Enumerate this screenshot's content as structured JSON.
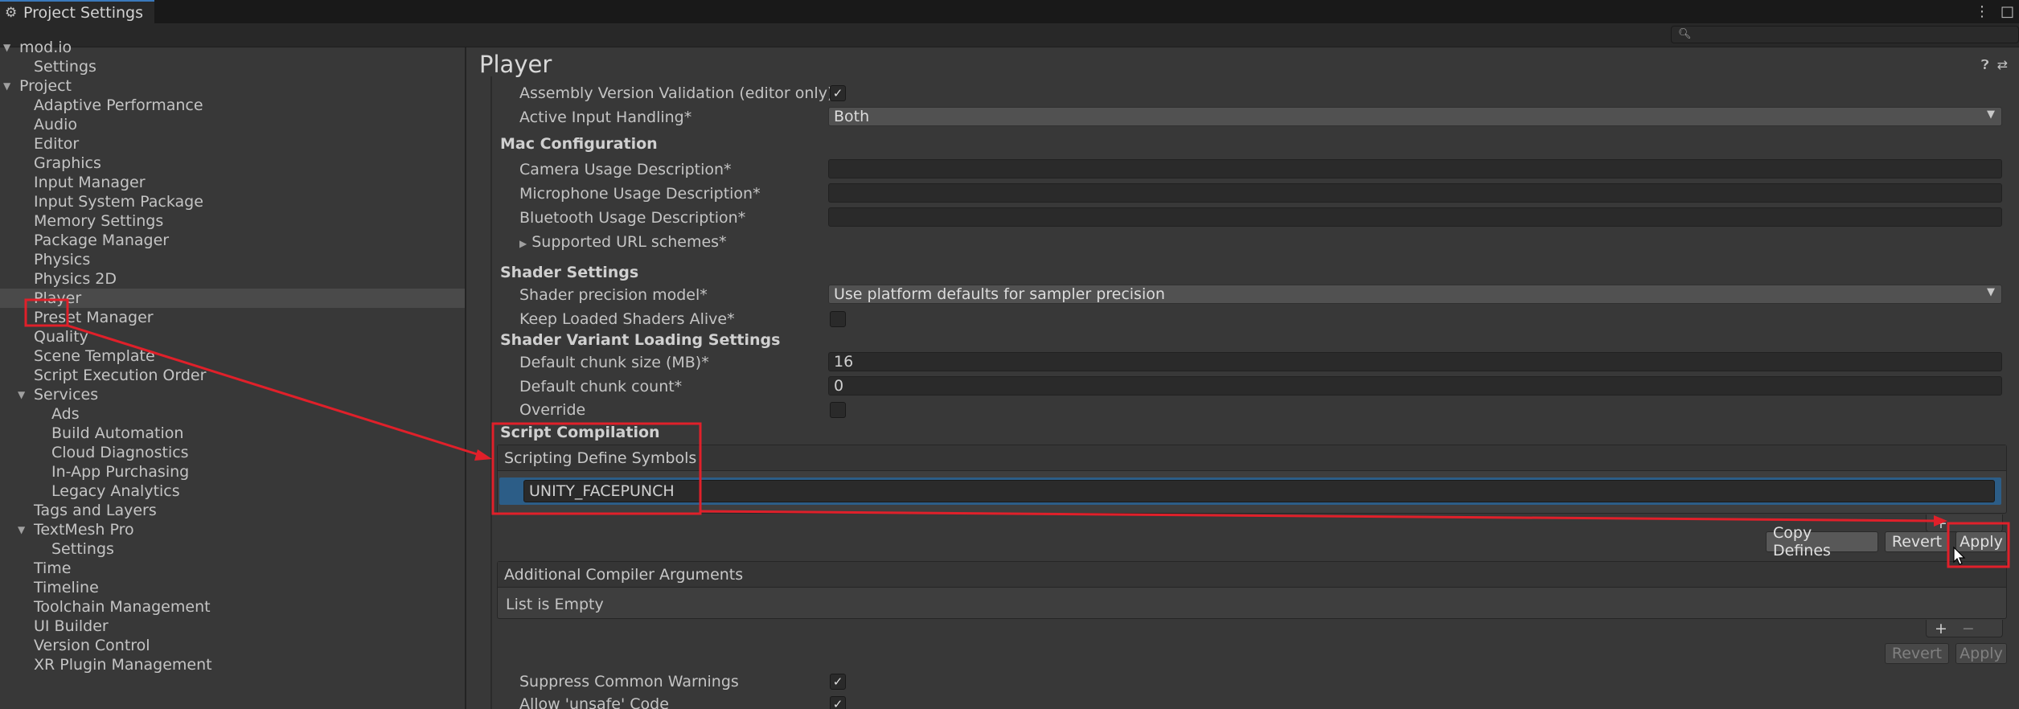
{
  "window": {
    "title": "Project Settings"
  },
  "search": {
    "placeholder": ""
  },
  "sidebar": {
    "items": [
      {
        "label": "mod.io",
        "level": 0,
        "expanded": true
      },
      {
        "label": "Settings",
        "level": 1
      },
      {
        "label": "Project",
        "level": 0,
        "expanded": true
      },
      {
        "label": "Adaptive Performance",
        "level": 1
      },
      {
        "label": "Audio",
        "level": 1
      },
      {
        "label": "Editor",
        "level": 1
      },
      {
        "label": "Graphics",
        "level": 1
      },
      {
        "label": "Input Manager",
        "level": 1
      },
      {
        "label": "Input System Package",
        "level": 1
      },
      {
        "label": "Memory Settings",
        "level": 1
      },
      {
        "label": "Package Manager",
        "level": 1
      },
      {
        "label": "Physics",
        "level": 1
      },
      {
        "label": "Physics 2D",
        "level": 1
      },
      {
        "label": "Player",
        "level": 1,
        "selected": true
      },
      {
        "label": "Preset Manager",
        "level": 1
      },
      {
        "label": "Quality",
        "level": 1
      },
      {
        "label": "Scene Template",
        "level": 1
      },
      {
        "label": "Script Execution Order",
        "level": 1
      },
      {
        "label": "Services",
        "level": 1,
        "expanded": true
      },
      {
        "label": "Ads",
        "level": 2
      },
      {
        "label": "Build Automation",
        "level": 2
      },
      {
        "label": "Cloud Diagnostics",
        "level": 2
      },
      {
        "label": "In-App Purchasing",
        "level": 2
      },
      {
        "label": "Legacy Analytics",
        "level": 2
      },
      {
        "label": "Tags and Layers",
        "level": 1
      },
      {
        "label": "TextMesh Pro",
        "level": 1,
        "expanded": true
      },
      {
        "label": "Settings",
        "level": 2
      },
      {
        "label": "Time",
        "level": 1
      },
      {
        "label": "Timeline",
        "level": 1
      },
      {
        "label": "Toolchain Management",
        "level": 1
      },
      {
        "label": "UI Builder",
        "level": 1
      },
      {
        "label": "Version Control",
        "level": 1
      },
      {
        "label": "XR Plugin Management",
        "level": 1
      }
    ]
  },
  "panel": {
    "title": "Player",
    "rows": {
      "assembly_validation": {
        "label": "Assembly Version Validation (editor only)",
        "checked": true
      },
      "active_input": {
        "label": "Active Input Handling*",
        "value": "Both"
      },
      "mac_header": "Mac Configuration",
      "camera_usage": {
        "label": "Camera Usage Description*",
        "value": ""
      },
      "microphone_usage": {
        "label": "Microphone Usage Description*",
        "value": ""
      },
      "bluetooth_usage": {
        "label": "Bluetooth Usage Description*",
        "value": ""
      },
      "url_schemes": {
        "label": "Supported URL schemes*"
      },
      "shader_header": "Shader Settings",
      "shader_precision": {
        "label": "Shader precision model*",
        "value": "Use platform defaults for sampler precision"
      },
      "keep_shaders": {
        "label": "Keep Loaded Shaders Alive*",
        "checked": false
      },
      "variant_header": "Shader Variant Loading Settings",
      "chunk_size": {
        "label": "Default chunk size (MB)*",
        "value": "16"
      },
      "chunk_count": {
        "label": "Default chunk count*",
        "value": "0"
      },
      "override": {
        "label": "Override",
        "checked": false
      },
      "script_header": "Script Compilation",
      "define_symbols": {
        "header": "Scripting Define Symbols",
        "entries": [
          "UNITY_FACEPUNCH"
        ]
      },
      "buttons": {
        "copy_defines": "Copy Defines",
        "revert": "Revert",
        "apply": "Apply"
      },
      "compiler_args": {
        "header": "Additional Compiler Arguments",
        "empty_text": "List is Empty"
      },
      "buttons2": {
        "revert": "Revert",
        "apply": "Apply"
      },
      "suppress_warnings": {
        "label": "Suppress Common Warnings",
        "checked": true
      },
      "allow_unsafe": {
        "label": "Allow 'unsafe' Code",
        "checked": true
      }
    }
  },
  "glyphs": {
    "plus": "+",
    "minus": "−",
    "check": "✓",
    "arrow_down": "▼",
    "arrow_right": "▶",
    "dropdown": "▼"
  },
  "colors": {
    "highlight_red": "#e0202a",
    "selection_blue": "#2c5d87",
    "tab_accent": "#3a79bb"
  }
}
